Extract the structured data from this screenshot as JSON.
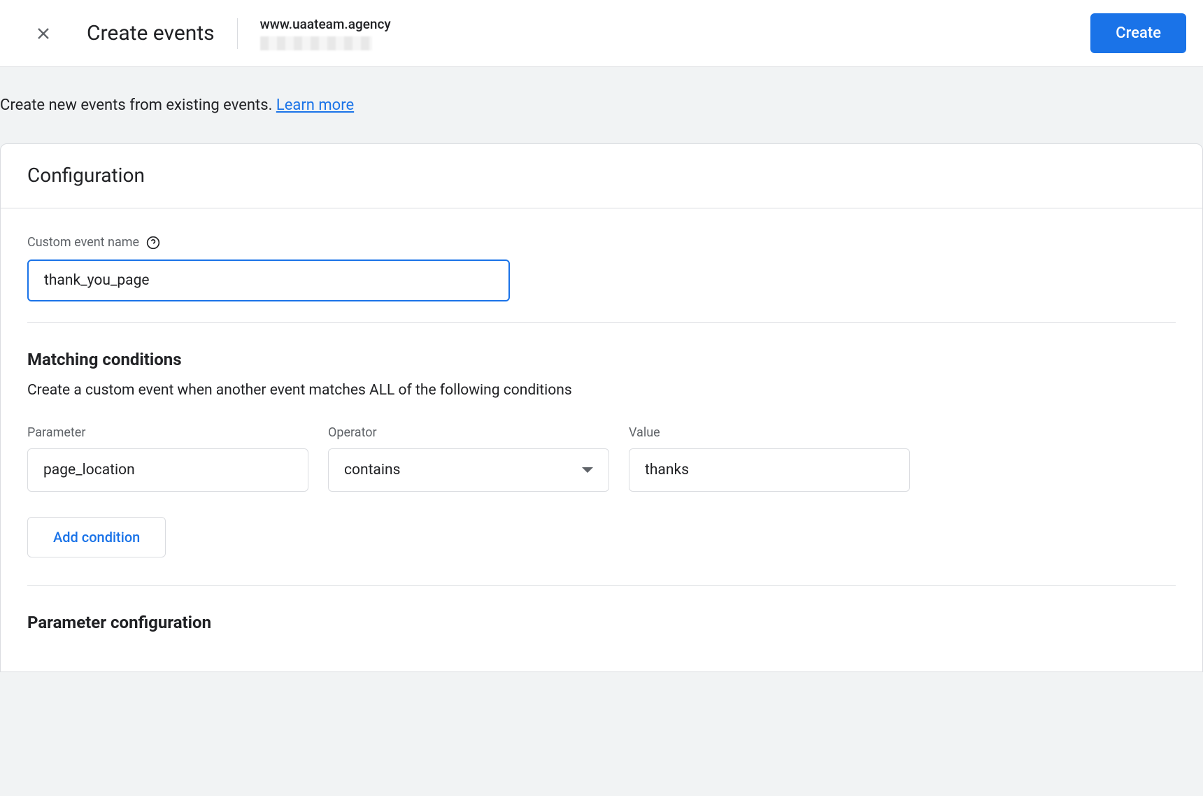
{
  "header": {
    "title": "Create events",
    "property_name": "www.uaateam.agency",
    "create_button": "Create"
  },
  "banner": {
    "text": "Create new events from existing events. ",
    "learn_more": "Learn more"
  },
  "config": {
    "title": "Configuration",
    "custom_event_label": "Custom event name",
    "custom_event_value": "thank_you_page"
  },
  "matching": {
    "title": "Matching conditions",
    "description": "Create a custom event when another event matches ALL of the following conditions",
    "parameter_label": "Parameter",
    "operator_label": "Operator",
    "value_label": "Value",
    "conditions": [
      {
        "parameter": "page_location",
        "operator": "contains",
        "value": "thanks"
      }
    ],
    "add_condition": "Add condition"
  },
  "param_config": {
    "title": "Parameter configuration"
  }
}
